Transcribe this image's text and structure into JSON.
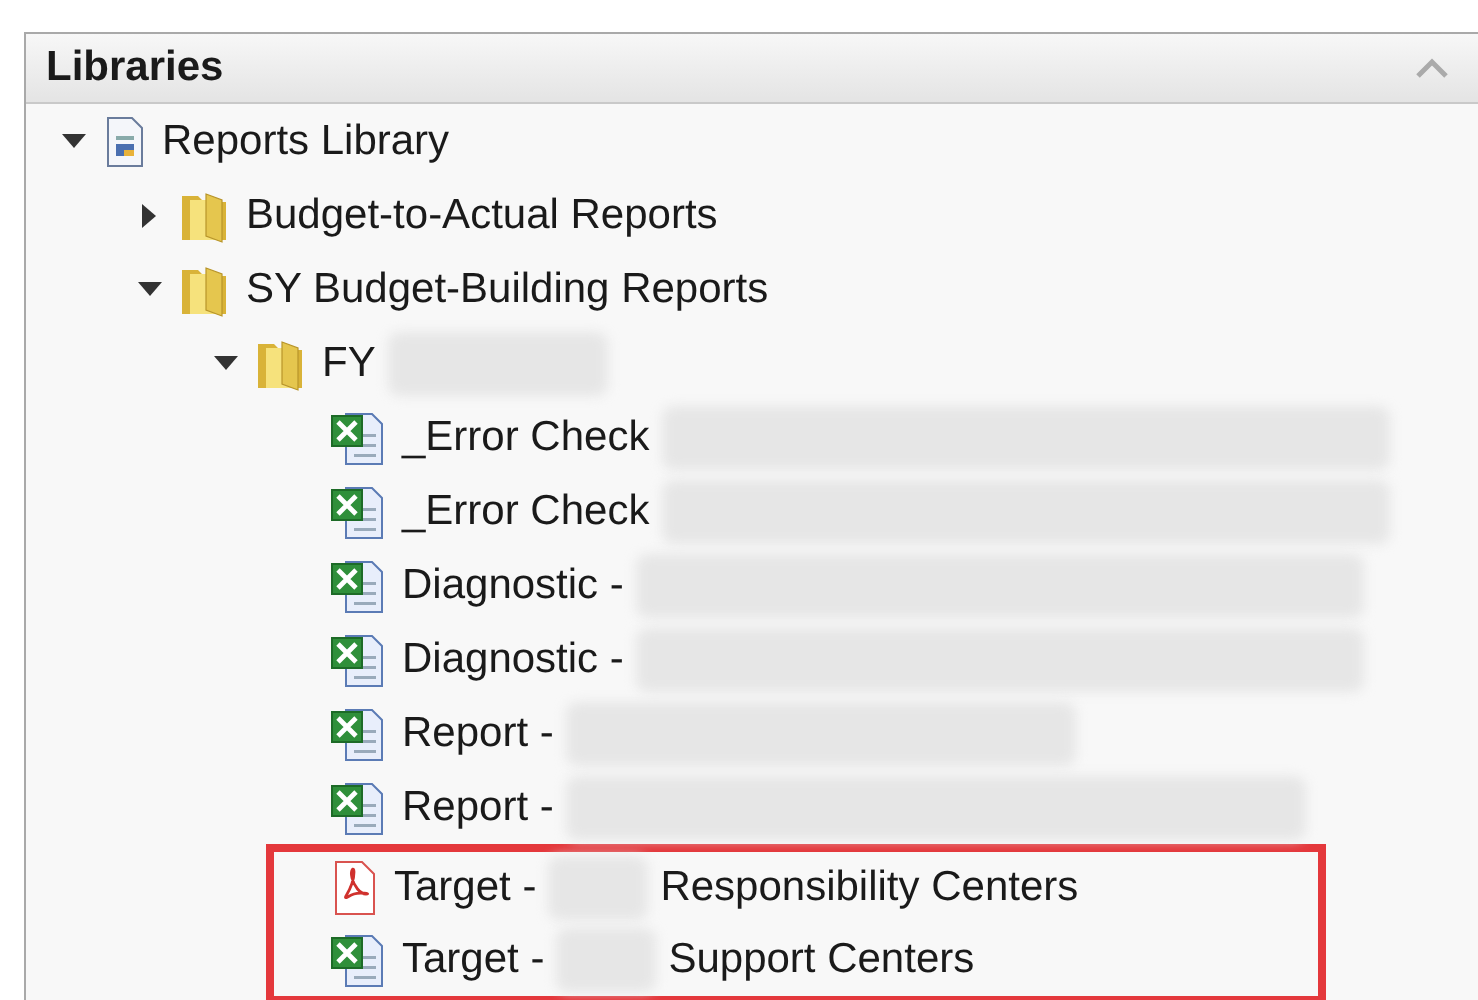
{
  "panel": {
    "title": "Libraries"
  },
  "tree": [
    {
      "kind": "library",
      "label": "Reports Library",
      "expanded": true,
      "children": [
        {
          "kind": "folder",
          "label": "Budget-to-Actual Reports",
          "expanded": false
        },
        {
          "kind": "folder",
          "label": "SY Budget-Building Reports",
          "expanded": true,
          "children": [
            {
              "kind": "folder",
              "label": "FY",
              "redacted": true,
              "expanded": true,
              "children": [
                {
                  "kind": "excel",
                  "label": "_Error Check",
                  "redacted": true,
                  "highlighted": false
                },
                {
                  "kind": "excel",
                  "label": "_Error Check",
                  "redacted": true,
                  "highlighted": false
                },
                {
                  "kind": "excel",
                  "label": "Diagnostic -",
                  "redacted": true,
                  "highlighted": false
                },
                {
                  "kind": "excel",
                  "label": "Diagnostic -",
                  "redacted": true,
                  "highlighted": false
                },
                {
                  "kind": "excel",
                  "label": "Report -",
                  "redacted": true,
                  "highlighted": false
                },
                {
                  "kind": "excel",
                  "label": "Report -",
                  "redacted": true,
                  "highlighted": false
                },
                {
                  "kind": "pdf",
                  "label": "Target -",
                  "redacted": true,
                  "label_after": "Responsibility Centers",
                  "highlighted": true
                },
                {
                  "kind": "excel",
                  "label": "Target -",
                  "redacted": true,
                  "label_after": "Support Centers",
                  "highlighted": true
                }
              ]
            }
          ]
        }
      ]
    }
  ]
}
